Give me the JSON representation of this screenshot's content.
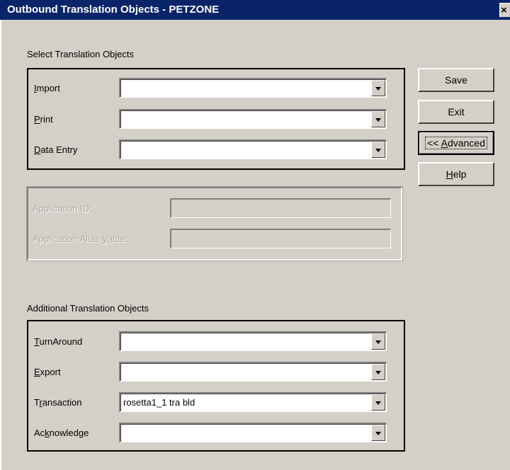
{
  "window": {
    "title": "Outbound Translation Objects - PETZONE",
    "close_glyph": "×"
  },
  "select_group": {
    "label": "Select Translation Objects",
    "fields": [
      {
        "label_pre": "",
        "label_mnemonic": "I",
        "label_post": "mport",
        "value": ""
      },
      {
        "label_pre": "",
        "label_mnemonic": "P",
        "label_post": "rint",
        "value": ""
      },
      {
        "label_pre": "",
        "label_mnemonic": "D",
        "label_post": "ata Entry",
        "value": ""
      }
    ]
  },
  "advanced_group": {
    "application_id": {
      "label": "Application ID:",
      "value": ""
    },
    "application_alias": {
      "label_pre": "Application Alias ",
      "label_mnemonic": "V",
      "label_post": "alue:",
      "value": ""
    }
  },
  "additional_group": {
    "label": "Additional Translation Objects",
    "fields": [
      {
        "label_pre": "",
        "label_mnemonic": "T",
        "label_post": "urnAround",
        "value": ""
      },
      {
        "label_pre": "",
        "label_mnemonic": "E",
        "label_post": "xport",
        "value": ""
      },
      {
        "label_pre": "T",
        "label_mnemonic": "r",
        "label_post": "ansaction",
        "value": "rosetta1_1 tra bld"
      },
      {
        "label_pre": "Ac",
        "label_mnemonic": "k",
        "label_post": "nowledge",
        "value": ""
      }
    ]
  },
  "buttons": {
    "save": {
      "label": "Save"
    },
    "exit": {
      "label": "Exit"
    },
    "advanced": {
      "label_pre": "<< ",
      "label_mnemonic": "A",
      "label_post": "dvanced"
    },
    "help": {
      "label_pre": "",
      "label_mnemonic": "H",
      "label_post": "elp"
    }
  }
}
